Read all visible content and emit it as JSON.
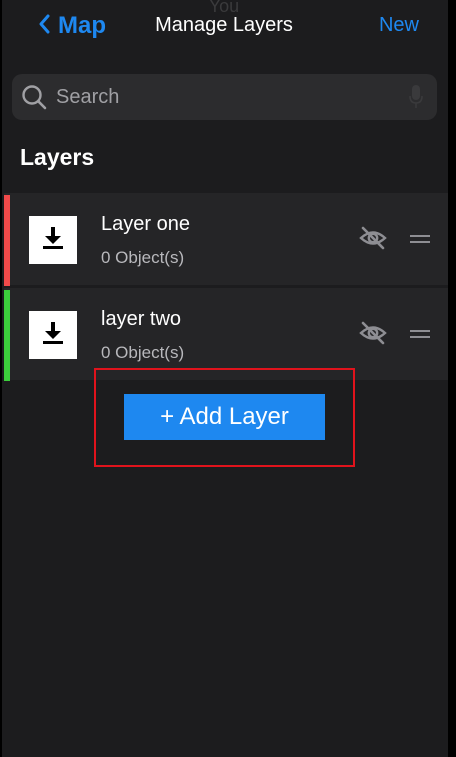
{
  "nav": {
    "ghost_text": "You",
    "back_label": "Map",
    "title": "Manage Layers",
    "new_label": "New"
  },
  "search": {
    "placeholder": "Search",
    "icon": "search-icon",
    "mic_icon": "microphone-icon"
  },
  "section_title": "Layers",
  "layers": [
    {
      "name": "Layer one",
      "count": "0 Object(s)",
      "color": "#f04a4a",
      "icon": "download-icon",
      "visibility_icon": "eye-slash-icon"
    },
    {
      "name": "layer two",
      "count": "0 Object(s)",
      "color": "#3ccf3c",
      "icon": "download-icon",
      "visibility_icon": "eye-slash-icon"
    }
  ],
  "add_button": {
    "label": "+ Add Layer"
  },
  "colors": {
    "accent": "#1e88f0",
    "background": "#1c1c1e",
    "row": "#252527",
    "highlight": "#e0131c"
  }
}
